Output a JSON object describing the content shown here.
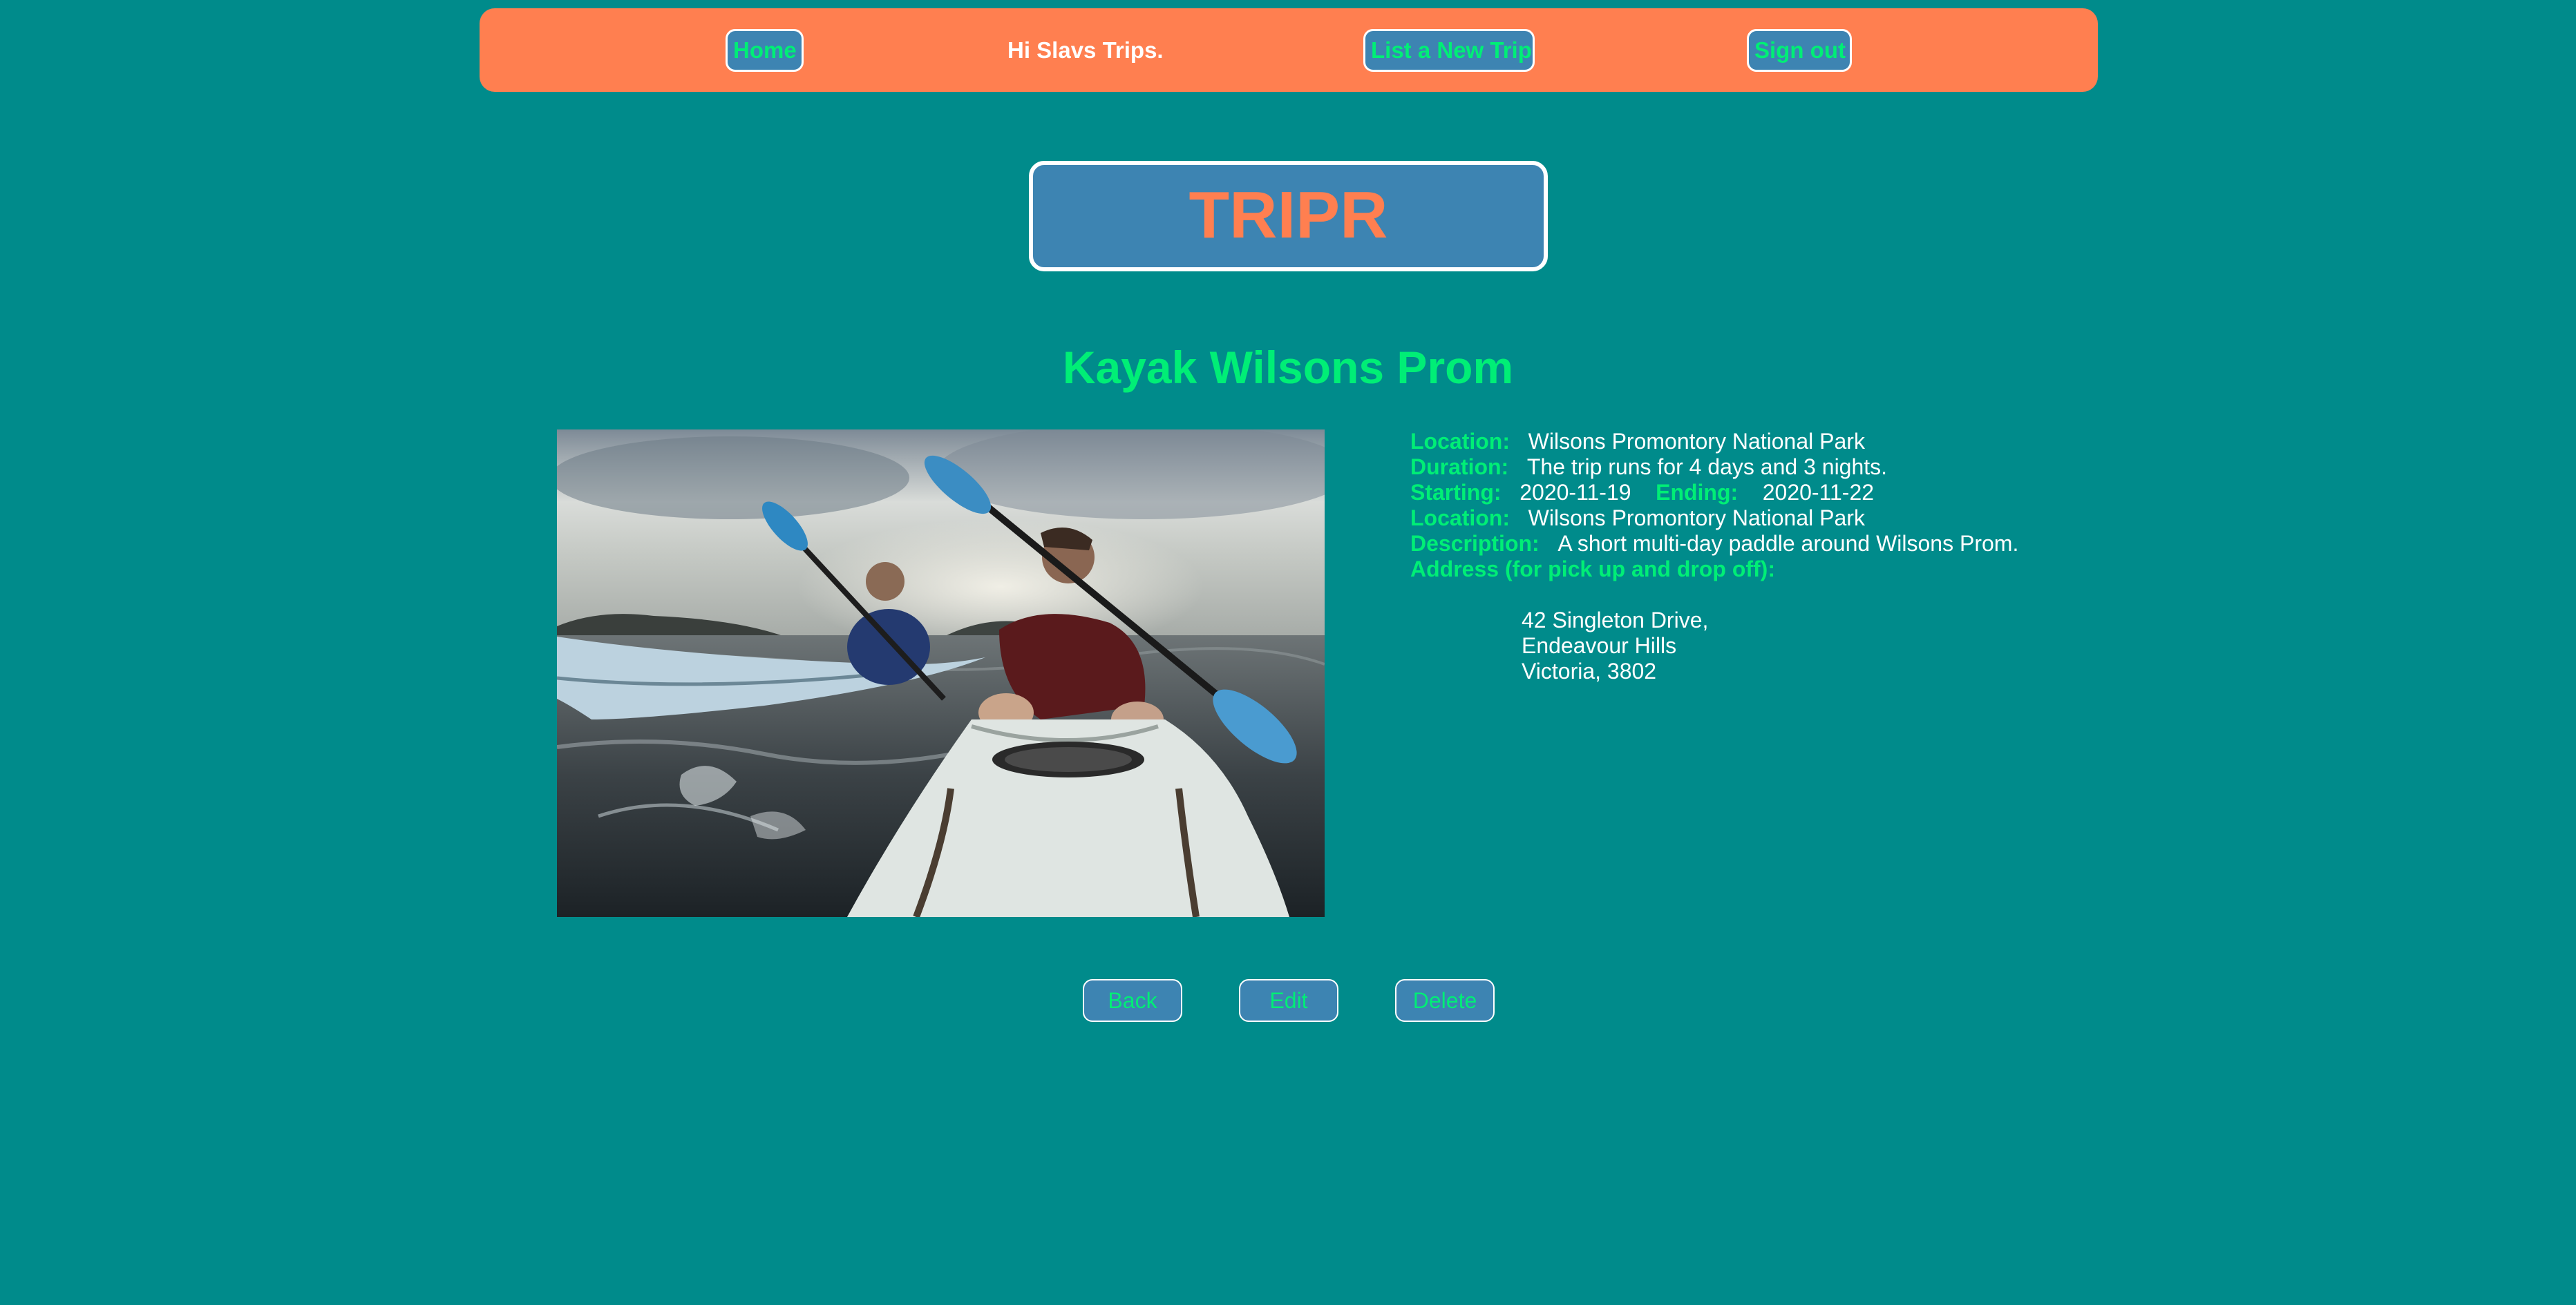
{
  "nav": {
    "home_label": "Home",
    "greeting": "Hi Slavs Trips.",
    "new_trip_label": "List a New Trip",
    "signout_label": "Sign out"
  },
  "logo": {
    "text": "TRIPR"
  },
  "trip": {
    "title": "Kayak Wilsons Prom",
    "photo_icon": "kayak-photo",
    "location_label": "Location:",
    "location": "Wilsons Promontory National Park",
    "duration_label": "Duration:",
    "duration": "The trip runs for 4 days and 3 nights.",
    "starting_label": "Starting:",
    "starting": "2020-11-19",
    "ending_label": "Ending:",
    "ending": "2020-11-22",
    "location2_label": "Location:",
    "location2": "Wilsons Promontory National Park",
    "description_label": "Description:",
    "description": "A short multi-day paddle around Wilsons Prom.",
    "address_label": "Address (for pick up and drop off):",
    "address": {
      "line1": "42 Singleton Drive,",
      "line2": "Endeavour Hills",
      "line3": "Victoria, 3802"
    }
  },
  "actions": {
    "back_label": "Back",
    "edit_label": "Edit",
    "delete_label": "Delete"
  },
  "colors": {
    "page_bg": "#008b8b",
    "nav_bg": "#ff7f50",
    "button_bg": "#3d84b2",
    "accent_green": "#00ee76",
    "logo_text": "#ff7f50"
  }
}
